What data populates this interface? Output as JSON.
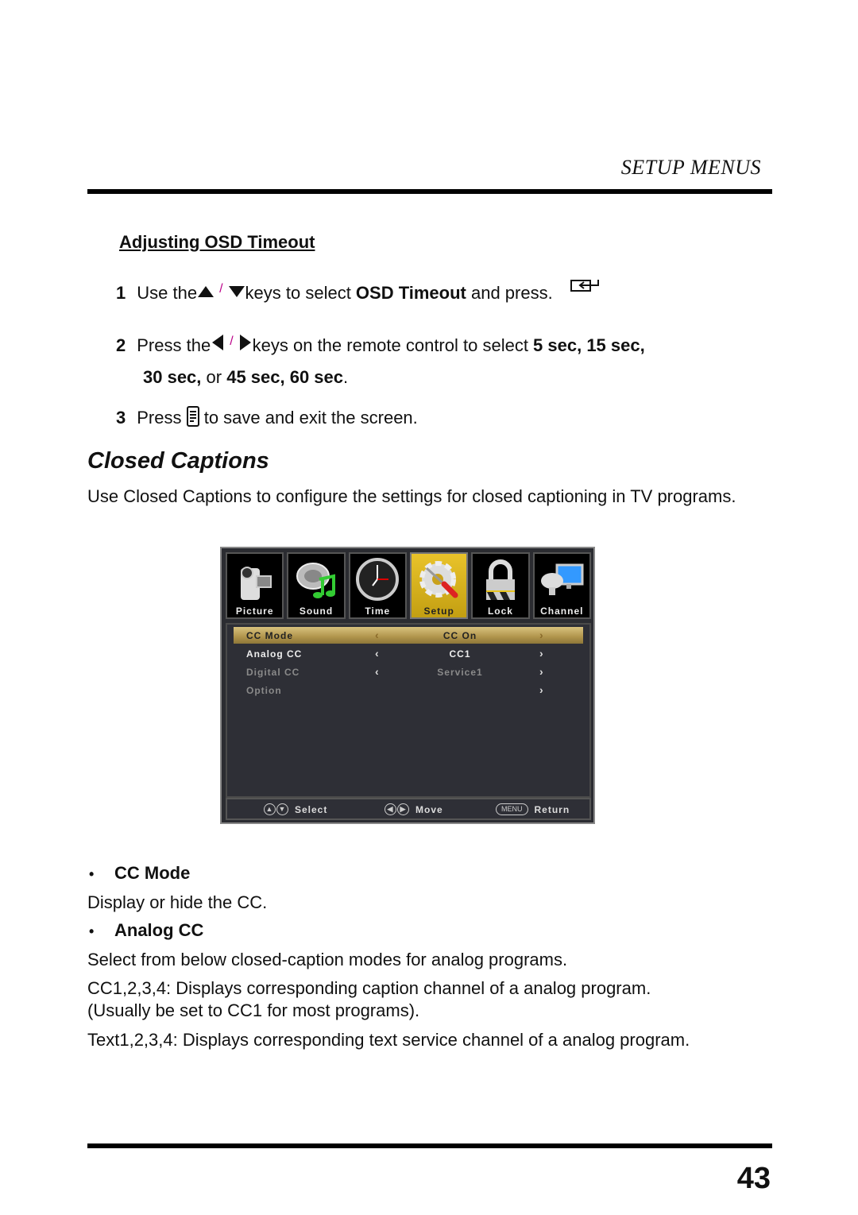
{
  "header": {
    "section": "SETUP MENUS"
  },
  "osd_timeout": {
    "heading": "Adjusting OSD Timeout",
    "steps": [
      {
        "num": "1",
        "pre": "Use the",
        "icons": [
          "up-arrow-icon",
          "down-arrow-icon"
        ],
        "mid": "keys to select ",
        "bold": "OSD Timeout",
        "post": " and press.",
        "end_icon": "enter-key-icon"
      },
      {
        "num": "2",
        "pre": "Press the",
        "icons": [
          "left-arrow-icon",
          "right-arrow-icon"
        ],
        "mid": "keys on the remote control to select ",
        "bold": "5 sec, 15 sec,",
        "line2_bold_a": "30 sec,",
        "line2_plain": " or ",
        "line2_bold_b": "45 sec, 60 sec",
        "line2_end": "."
      },
      {
        "num": "3",
        "pre": "Press ",
        "icon": "menu-key-icon",
        "post": " to save and exit the screen."
      }
    ]
  },
  "closed_captions": {
    "title": "Closed Captions",
    "intro": "Use Closed Captions to configure the settings for closed captioning in TV programs.",
    "items": [
      {
        "label": "CC Mode",
        "desc": [
          "Display or hide the CC."
        ]
      },
      {
        "label": "Analog CC",
        "desc": [
          "Select from below closed-caption modes for analog programs.",
          "CC1,2,3,4: Displays corresponding caption channel of a analog program.",
          "(Usually be set to CC1 for most programs).",
          "Text1,2,3,4: Displays corresponding text service channel of a analog program."
        ]
      }
    ]
  },
  "osd": {
    "tabs": [
      {
        "label": "Picture",
        "icon": "camcorder-icon",
        "active": false
      },
      {
        "label": "Sound",
        "icon": "speaker-note-icon",
        "active": false
      },
      {
        "label": "Time",
        "icon": "clock-icon",
        "active": false
      },
      {
        "label": "Setup",
        "icon": "gear-screwdriver-icon",
        "active": true
      },
      {
        "label": "Lock",
        "icon": "padlock-icon",
        "active": false
      },
      {
        "label": "Channel",
        "icon": "satellite-monitor-icon",
        "active": false
      }
    ],
    "rows": [
      {
        "name": "CC Mode",
        "value": "CC On",
        "left": "‹",
        "right": "›",
        "state": "selected"
      },
      {
        "name": "Analog CC",
        "value": "CC1",
        "left": "‹",
        "right": "›",
        "state": "normal"
      },
      {
        "name": "Digital CC",
        "value": "Service1",
        "left": "‹",
        "right": "›",
        "state": "disabled"
      },
      {
        "name": "Option",
        "value": "",
        "left": "",
        "right": "›",
        "state": "disabled"
      }
    ],
    "footer": {
      "select": "Select",
      "move": "Move",
      "menu_key": "MENU",
      "return": "Return"
    },
    "colors": {
      "active_tab": "#e0b920",
      "selected_row": "#c4a65e",
      "panel": "#2e2f36"
    }
  },
  "page_number": "43"
}
